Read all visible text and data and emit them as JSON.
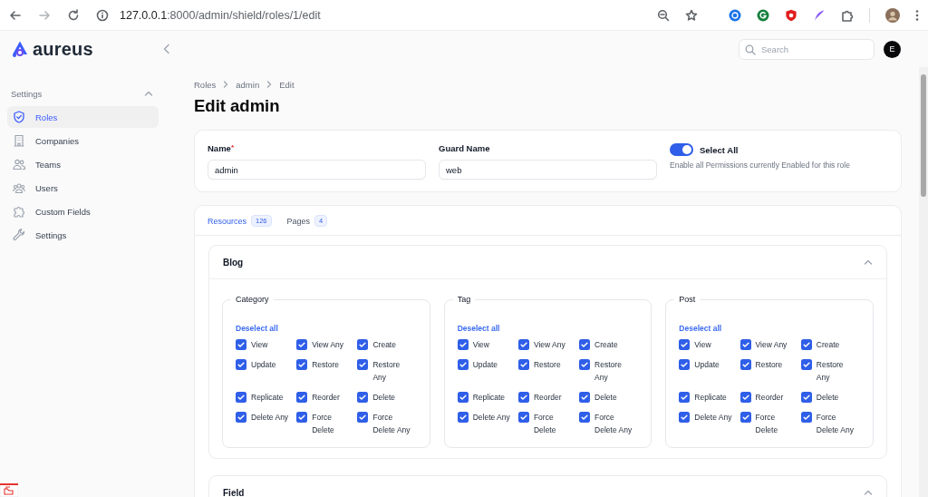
{
  "browser": {
    "url_host": "127.0.0.1",
    "url_path": ":8000/admin/shield/roles/1/edit"
  },
  "app": {
    "logo_text": "aureus",
    "search": {
      "placeholder": "Search"
    },
    "user_initial": "E"
  },
  "sidebar": {
    "group": "Settings",
    "expanded": true,
    "items": [
      {
        "label": "Roles",
        "selected": true
      },
      {
        "label": "Companies",
        "selected": false
      },
      {
        "label": "Teams",
        "selected": false
      },
      {
        "label": "Users",
        "selected": false
      },
      {
        "label": "Custom Fields",
        "selected": false
      },
      {
        "label": "Settings",
        "selected": false
      }
    ]
  },
  "breadcrumbs": [
    "Roles",
    "admin",
    "Edit"
  ],
  "title": "Edit admin",
  "form": {
    "name": {
      "label": "Name",
      "required_mark": "*",
      "value": "admin"
    },
    "guard_name": {
      "label": "Guard Name",
      "value": "web"
    },
    "select_all": {
      "label": "Select All",
      "on": true,
      "hint": "Enable all Permissions currently Enabled for this role"
    }
  },
  "tabs": [
    {
      "label": "Resources",
      "count": "126",
      "selected": true
    },
    {
      "label": "Pages",
      "count": "4",
      "selected": false
    }
  ],
  "sections": [
    {
      "title": "Blog",
      "expanded": true,
      "resources": [
        {
          "name": "Category",
          "toggle_label": "Deselect all",
          "permissions": [
            {
              "label": "View",
              "checked": true
            },
            {
              "label": "View Any",
              "checked": true
            },
            {
              "label": "Create",
              "checked": true
            },
            {
              "label": "Update",
              "checked": true
            },
            {
              "label": "Restore",
              "checked": true
            },
            {
              "label": "Restore Any",
              "checked": true
            },
            {
              "label": "Replicate",
              "checked": true
            },
            {
              "label": "Reorder",
              "checked": true
            },
            {
              "label": "Delete",
              "checked": true
            },
            {
              "label": "Delete Any",
              "checked": true
            },
            {
              "label": "Force Delete",
              "checked": true
            },
            {
              "label": "Force Delete Any",
              "checked": true
            }
          ]
        },
        {
          "name": "Tag",
          "toggle_label": "Deselect all",
          "permissions": [
            {
              "label": "View",
              "checked": true
            },
            {
              "label": "View Any",
              "checked": true
            },
            {
              "label": "Create",
              "checked": true
            },
            {
              "label": "Update",
              "checked": true
            },
            {
              "label": "Restore",
              "checked": true
            },
            {
              "label": "Restore Any",
              "checked": true
            },
            {
              "label": "Replicate",
              "checked": true
            },
            {
              "label": "Reorder",
              "checked": true
            },
            {
              "label": "Delete",
              "checked": true
            },
            {
              "label": "Delete Any",
              "checked": true
            },
            {
              "label": "Force Delete",
              "checked": true
            },
            {
              "label": "Force Delete Any",
              "checked": true
            }
          ]
        },
        {
          "name": "Post",
          "toggle_label": "Deselect all",
          "permissions": [
            {
              "label": "View",
              "checked": true
            },
            {
              "label": "View Any",
              "checked": true
            },
            {
              "label": "Create",
              "checked": true
            },
            {
              "label": "Update",
              "checked": true
            },
            {
              "label": "Restore",
              "checked": true
            },
            {
              "label": "Restore Any",
              "checked": true
            },
            {
              "label": "Replicate",
              "checked": true
            },
            {
              "label": "Reorder",
              "checked": true
            },
            {
              "label": "Delete",
              "checked": true
            },
            {
              "label": "Delete Any",
              "checked": true
            },
            {
              "label": "Force Delete",
              "checked": true
            },
            {
              "label": "Force Delete Any",
              "checked": true
            }
          ]
        }
      ]
    },
    {
      "title": "Field",
      "expanded": true
    }
  ]
}
